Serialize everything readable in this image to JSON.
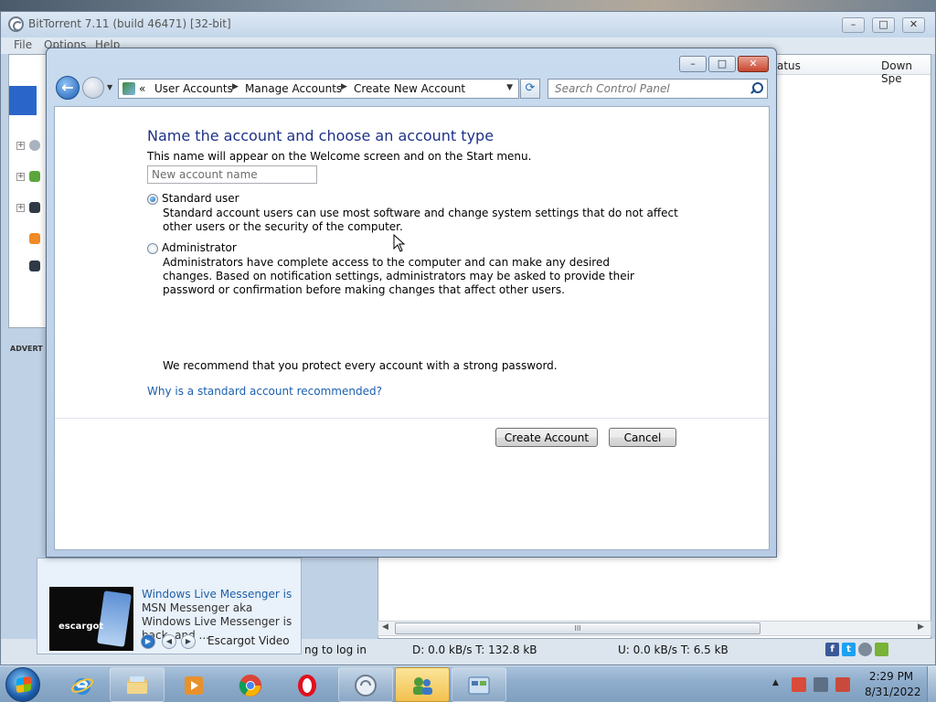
{
  "bittorrent": {
    "title": "BitTorrent 7.11  (build 46471) [32-bit]",
    "menu": [
      "File",
      "Options",
      "Help"
    ],
    "controls": {
      "minimize": "–",
      "maximize": "□",
      "close": "✕"
    },
    "tree_toggles": [
      "+",
      "+",
      "+"
    ],
    "advert_label": "ADVERT",
    "columns": {
      "status": "atus",
      "down_speed": "Down Spe"
    },
    "scrollbar": {
      "grip": "III",
      "left": "◀",
      "right": "▶"
    },
    "status": {
      "login": "ng to log in",
      "download": "D: 0.0 kB/s T: 132.8 kB",
      "upload": "U: 0.0 kB/s T: 6.5 kB"
    },
    "social_icons": [
      "facebook-icon",
      "twitter-icon",
      "web-icon",
      "android-icon"
    ],
    "ad": {
      "title": "Windows Live Messenger is ...",
      "description": "MSN Messenger aka Windows Live Messenger is back, and ...",
      "source": "Escargot Video",
      "thumb_text": "escargot",
      "controls": [
        "▶",
        "◀",
        "▶"
      ]
    }
  },
  "control_panel": {
    "controls": {
      "minimize": "–",
      "maximize": "□",
      "close": "✕"
    },
    "back_glyph": "←",
    "history_glyph": "▼",
    "refresh_glyph": "⟳",
    "breadcrumb": {
      "root": "«",
      "items": [
        "User Accounts",
        "Manage Accounts",
        "Create New Account"
      ],
      "separator": "▶",
      "dropdown": "▼"
    },
    "search_placeholder": "Search Control Panel",
    "heading": "Name the account and choose an account type",
    "subtext": "This name will appear on the Welcome screen and on the Start menu.",
    "name_placeholder": "New account name",
    "options": [
      {
        "label": "Standard user",
        "checked": true,
        "description": "Standard account users can use most software and change system settings that do not affect other users or the security of the computer."
      },
      {
        "label": "Administrator",
        "checked": false,
        "description": "Administrators have complete access to the computer and can make any desired changes. Based on notification settings, administrators may be asked to provide their password or confirmation before making changes that affect other users."
      }
    ],
    "recommendation": "We recommend that you protect every account with a strong password.",
    "why_link": "Why is a standard account recommended?",
    "buttons": {
      "create": "Create Account",
      "cancel": "Cancel"
    }
  },
  "taskbar": {
    "pinned": [
      "internet-explorer-icon",
      "windows-explorer-icon",
      "media-player-icon",
      "chrome-icon",
      "opera-icon",
      "bittorrent-icon",
      "user-accounts-icon",
      "control-panel-icon"
    ],
    "tray_expand": "▲",
    "clock": {
      "time": "2:29 PM",
      "date": "8/31/2022"
    }
  },
  "colors": {
    "heading": "#1e3287",
    "link": "#1b5fad",
    "taskbar": "#8eaccb",
    "active_task": "#f2c14e"
  }
}
